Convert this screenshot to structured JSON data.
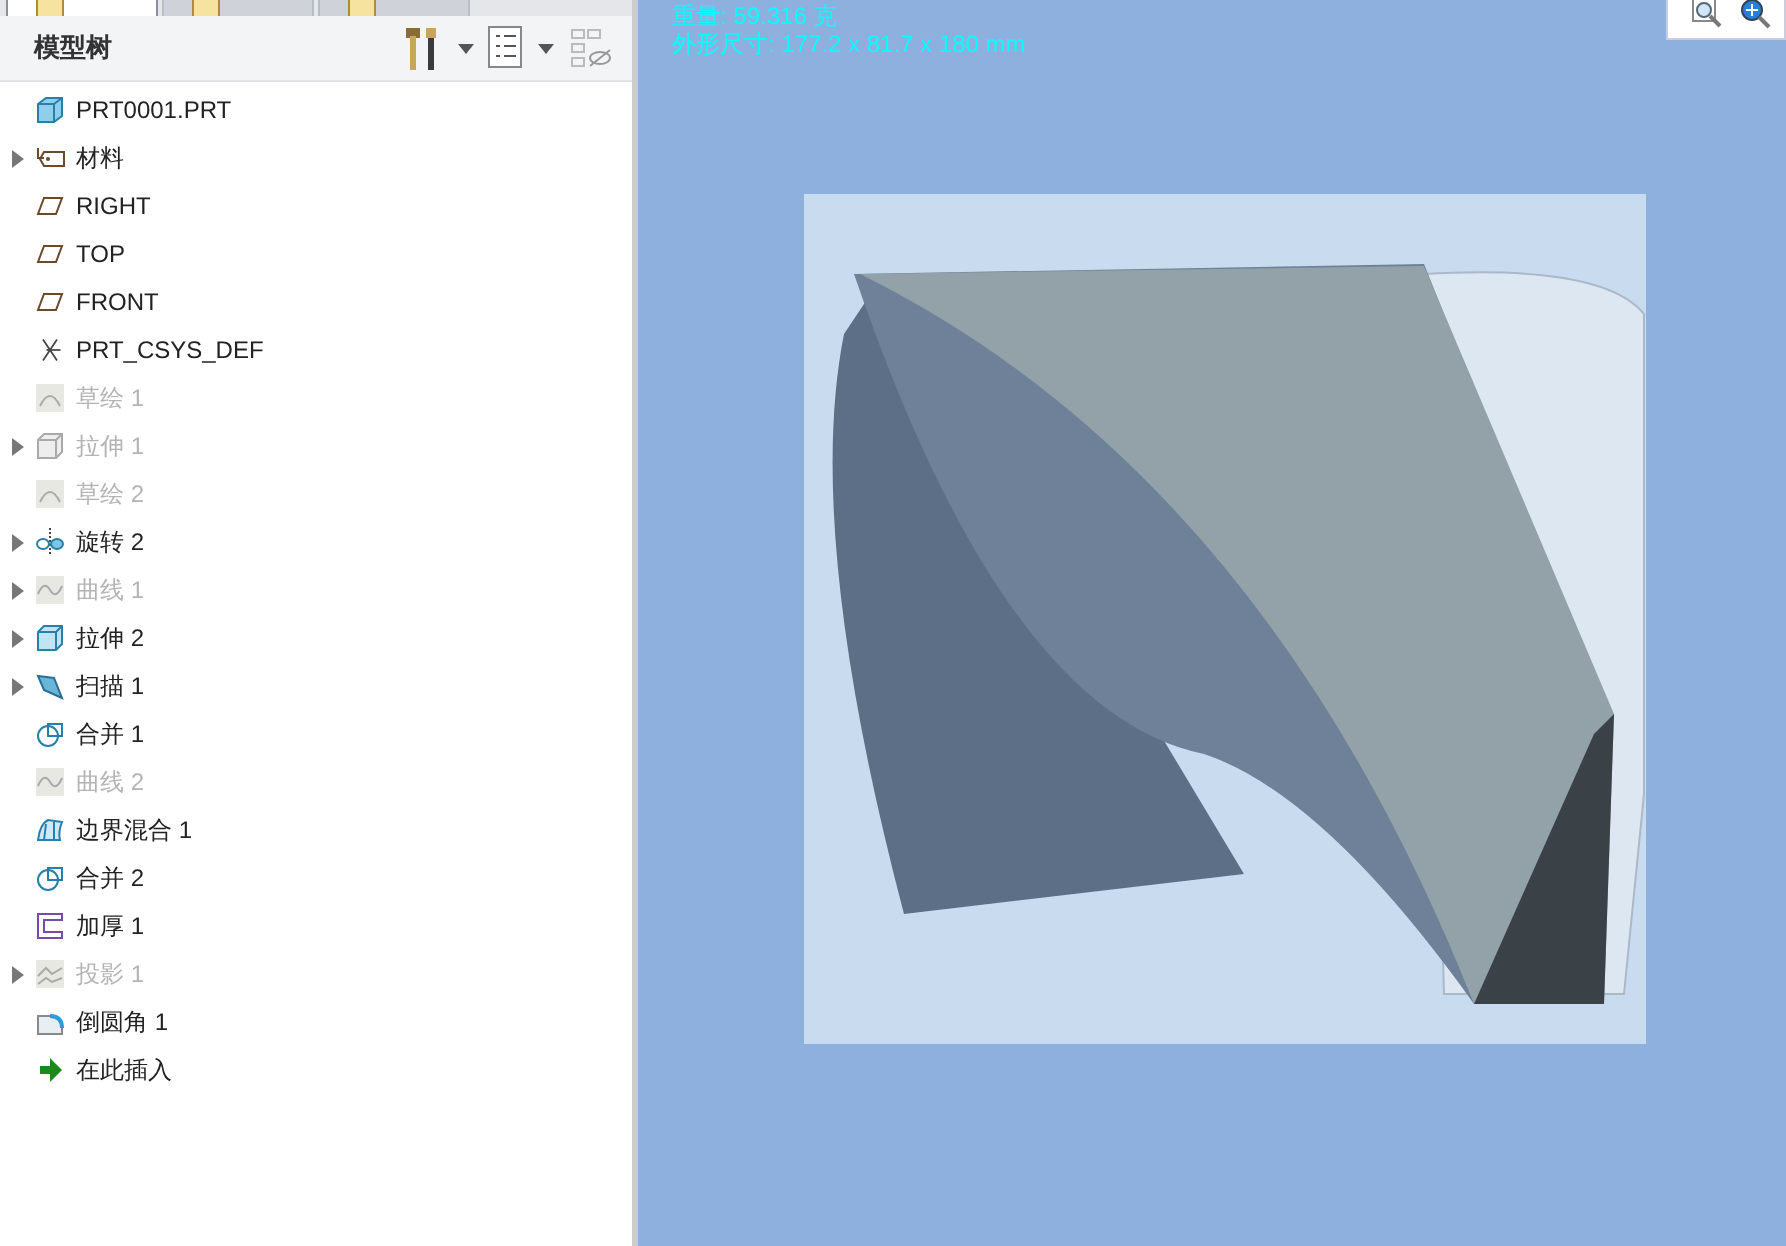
{
  "panel": {
    "title": "模型树",
    "tabs": [
      {
        "selected": true
      },
      {
        "selected": false
      },
      {
        "selected": false
      }
    ]
  },
  "tree": {
    "root": "PRT0001.PRT",
    "items": [
      {
        "label": "材料",
        "kind": "material",
        "expandable": true,
        "disabled": false
      },
      {
        "label": "RIGHT",
        "kind": "plane",
        "expandable": false,
        "disabled": false
      },
      {
        "label": "TOP",
        "kind": "plane",
        "expandable": false,
        "disabled": false
      },
      {
        "label": "FRONT",
        "kind": "plane",
        "expandable": false,
        "disabled": false
      },
      {
        "label": "PRT_CSYS_DEF",
        "kind": "csys",
        "expandable": false,
        "disabled": false
      },
      {
        "label": "草绘 1",
        "kind": "sketch",
        "expandable": false,
        "disabled": true
      },
      {
        "label": "拉伸 1",
        "kind": "extrude",
        "expandable": true,
        "disabled": true
      },
      {
        "label": "草绘 2",
        "kind": "sketch",
        "expandable": false,
        "disabled": true
      },
      {
        "label": "旋转 2",
        "kind": "revolve",
        "expandable": true,
        "disabled": false
      },
      {
        "label": "曲线 1",
        "kind": "curve",
        "expandable": true,
        "disabled": true
      },
      {
        "label": "拉伸 2",
        "kind": "extrude",
        "expandable": true,
        "disabled": false
      },
      {
        "label": "扫描 1",
        "kind": "sweep",
        "expandable": true,
        "disabled": false
      },
      {
        "label": "合并 1",
        "kind": "merge",
        "expandable": false,
        "disabled": false
      },
      {
        "label": "曲线 2",
        "kind": "curve",
        "expandable": false,
        "disabled": true
      },
      {
        "label": "边界混合 1",
        "kind": "blend",
        "expandable": false,
        "disabled": false
      },
      {
        "label": "合并 2",
        "kind": "merge",
        "expandable": false,
        "disabled": false
      },
      {
        "label": "加厚 1",
        "kind": "thicken",
        "expandable": false,
        "disabled": false
      },
      {
        "label": "投影 1",
        "kind": "project",
        "expandable": true,
        "disabled": true
      },
      {
        "label": "倒圆角 1",
        "kind": "round",
        "expandable": false,
        "disabled": false
      },
      {
        "label": "在此插入",
        "kind": "insert",
        "expandable": false,
        "disabled": false
      }
    ]
  },
  "viewport": {
    "info": [
      "重量: 59.316 克",
      "外形尺寸: 177.2 x 81.7 x 180 mm"
    ]
  }
}
